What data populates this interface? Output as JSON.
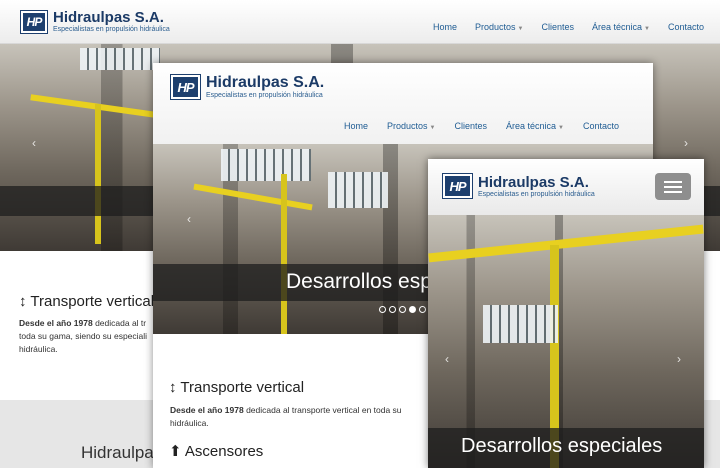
{
  "brand": {
    "logo_mark": "HP",
    "name": "Hidraulpas S.A.",
    "tagline": "Especialistas en propulsión hidráulica"
  },
  "nav": {
    "home": "Home",
    "productos": "Productos",
    "clientes": "Clientes",
    "area_tecnica": "Área técnica",
    "contacto": "Contacto"
  },
  "slider": {
    "caption_full": "Desarrollos especiales",
    "caption_partial": "Desarrollos esp",
    "prev_glyph": "‹",
    "next_glyph": "›"
  },
  "section": {
    "updown_glyph": "↕",
    "title": "Transporte vertical",
    "intro_bold": "Desde el año 1978",
    "intro_back": " dedicada al tr",
    "intro_back_line2": "toda su gama, siendo su especiali",
    "intro_back_line3": "hidráulica.",
    "intro_mid": " dedicada al transporte vertical en toda su",
    "intro_mid_line2": "hidráulica.",
    "sub_icon": "⬆",
    "sub_title": "Ascensores"
  },
  "footer_title": "Hidraulpas",
  "colors": {
    "brand_blue": "#1d3f6e",
    "link_blue": "#1f5c93",
    "beam_yellow": "#e8d020"
  },
  "icons": [
    "logo-icon",
    "caret-down-icon",
    "chevron-left-icon",
    "chevron-right-icon",
    "updown-icon",
    "arrow-up-circle-icon",
    "hamburger-icon"
  ]
}
